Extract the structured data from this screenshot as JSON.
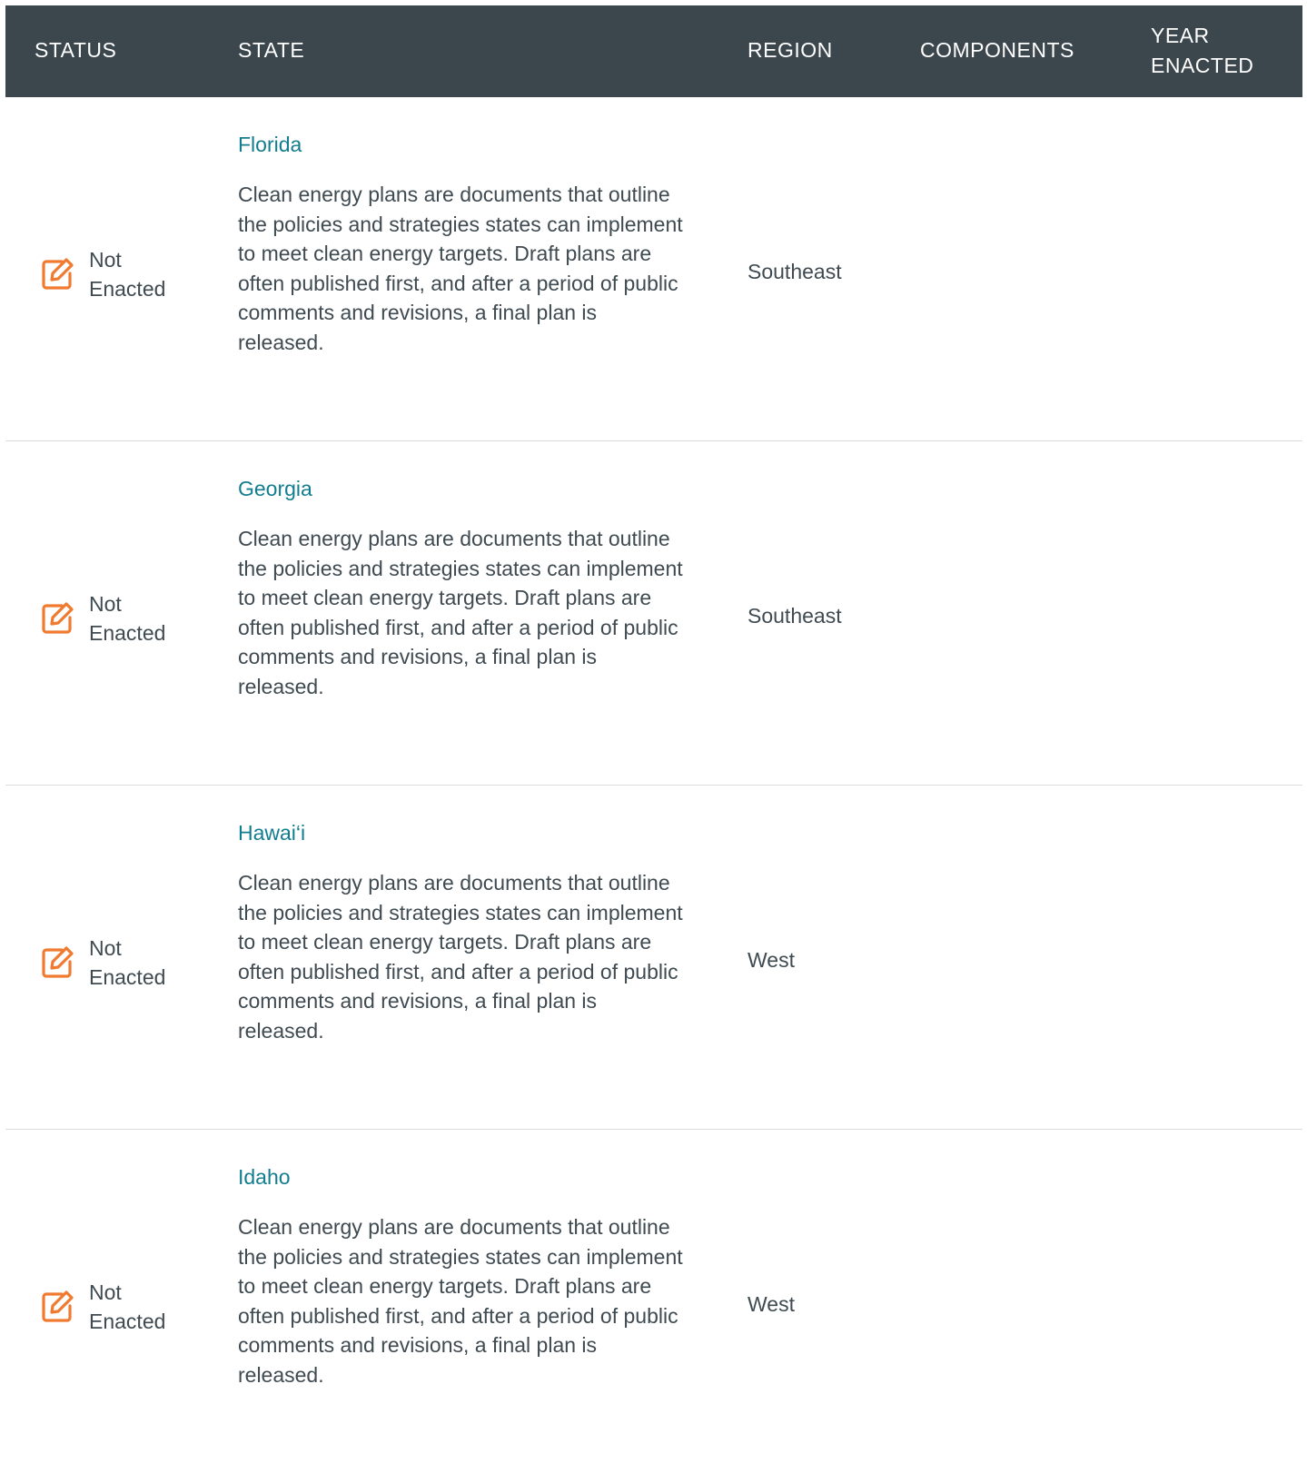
{
  "table": {
    "headers": {
      "status": "STATUS",
      "state": "STATE",
      "region": "REGION",
      "components": "COMPONENTS",
      "year_enacted": "YEAR ENACTED"
    },
    "rows": [
      {
        "status": "Not Enacted",
        "state": "Florida",
        "description": "Clean energy plans are documents that outline the policies and strategies states can implement to meet clean energy targets. Draft plans are often published first, and after a period of public comments and revisions, a final plan is released.",
        "region": "Southeast",
        "components": "",
        "year_enacted": ""
      },
      {
        "status": "Not Enacted",
        "state": "Georgia",
        "description": "Clean energy plans are documents that outline the policies and strategies states can implement to meet clean energy targets. Draft plans are often published first, and after a period of public comments and revisions, a final plan is released.",
        "region": "Southeast",
        "components": "",
        "year_enacted": ""
      },
      {
        "status": "Not Enacted",
        "state": "Hawai‘i",
        "description": "Clean energy plans are documents that outline the policies and strategies states can implement to meet clean energy targets. Draft plans are often published first, and after a period of public comments and revisions, a final plan is released.",
        "region": "West",
        "components": "",
        "year_enacted": ""
      },
      {
        "status": "Not Enacted",
        "state": "Idaho",
        "description": "Clean energy plans are documents that outline the policies and strategies states can implement to meet clean energy targets. Draft plans are often published first, and after a period of public comments and revisions, a final plan is released.",
        "region": "West",
        "components": "",
        "year_enacted": ""
      }
    ]
  },
  "icons": {
    "status": "edit-pencil-icon"
  },
  "colors": {
    "header_bg": "#3c474d",
    "header_text": "#ffffff",
    "link": "#127d8f",
    "icon": "#f07a2f",
    "body_text": "#3f4a51",
    "divider": "#d9dde0"
  }
}
